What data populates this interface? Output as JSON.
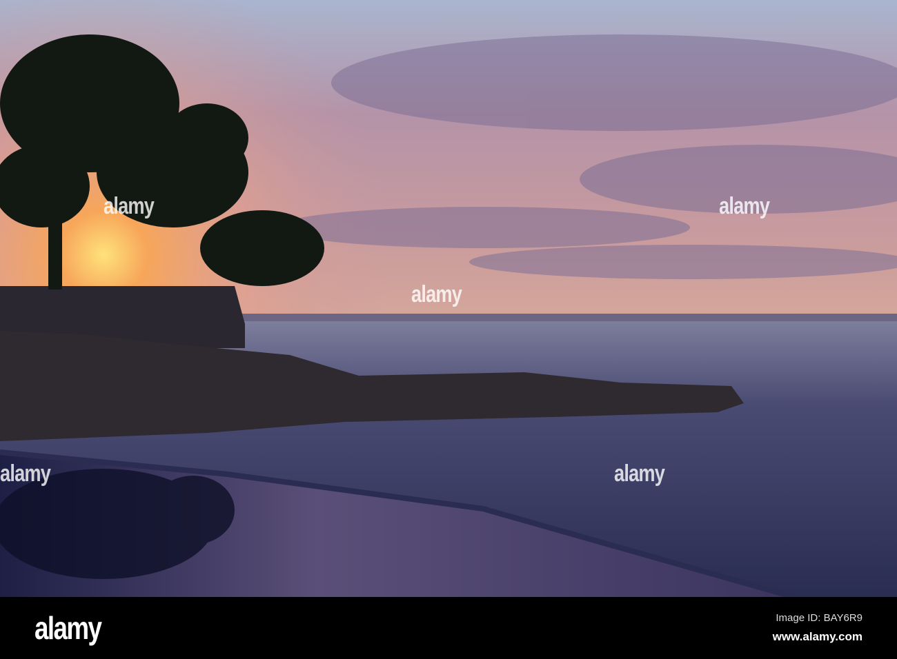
{
  "watermark": {
    "text": "alamy"
  },
  "footer": {
    "logo": "alamy",
    "image_id": "Image ID: BAY6R9",
    "website": "www.alamy.com"
  },
  "colors": {
    "sky_top": "#b7c3d6",
    "glow": "#ffb347",
    "sea": "#2c3054",
    "cloud": "#8a7aa0"
  }
}
